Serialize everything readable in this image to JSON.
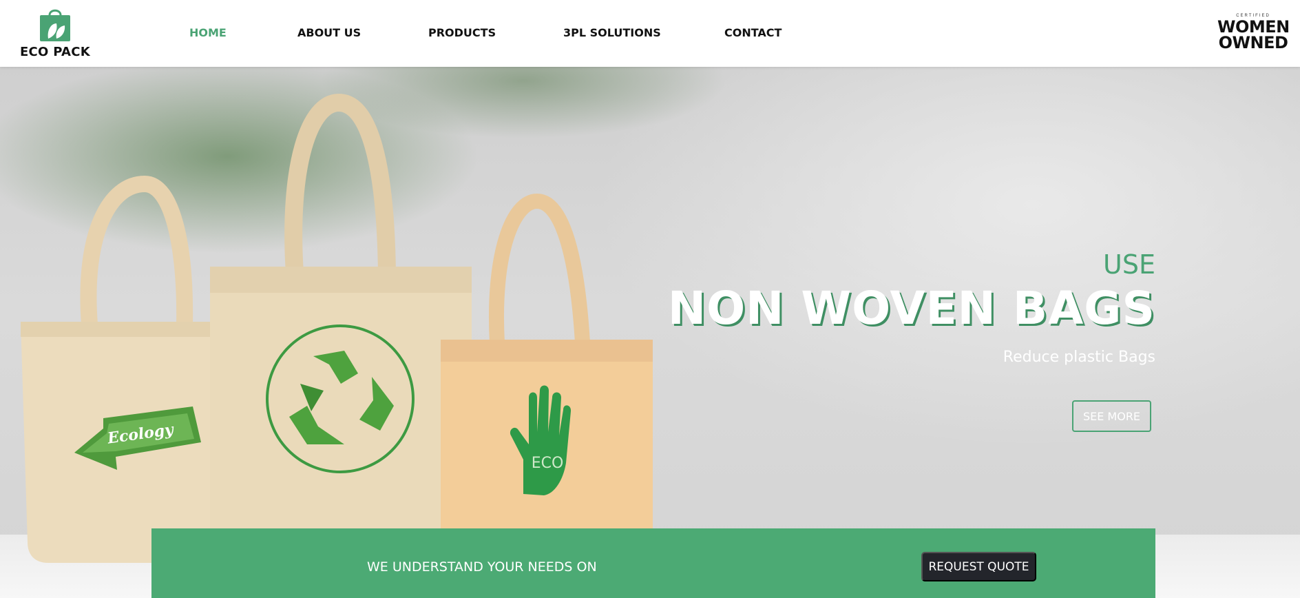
{
  "brand": {
    "name": "ECO PACK",
    "accent": "#4aa374",
    "dark": "#23252b"
  },
  "nav": {
    "items": [
      {
        "label": "HOME",
        "active": true
      },
      {
        "label": "ABOUT US",
        "active": false
      },
      {
        "label": "PRODUCTS",
        "active": false
      },
      {
        "label": "3PL SOLUTIONS",
        "active": false
      },
      {
        "label": "CONTACT",
        "active": false
      }
    ]
  },
  "badge": {
    "top": "CERTIFIED",
    "line1": "WOMEN",
    "line2": "OWNED"
  },
  "hero": {
    "eyebrow": "USE",
    "title": "NON WOVEN BAGS",
    "subtitle": "Reduce plastic Bags",
    "button": "SEE MORE",
    "bag_labels": {
      "left": "Ecology",
      "right": "ECO"
    }
  },
  "cta": {
    "text": "WE UNDERSTAND YOUR NEEDS ON",
    "button": "REQUEST QUOTE"
  },
  "icons": [
    "shopping-bag-leaf-icon",
    "recycle-icon",
    "hand-icon",
    "leaf-arrow-icon"
  ]
}
